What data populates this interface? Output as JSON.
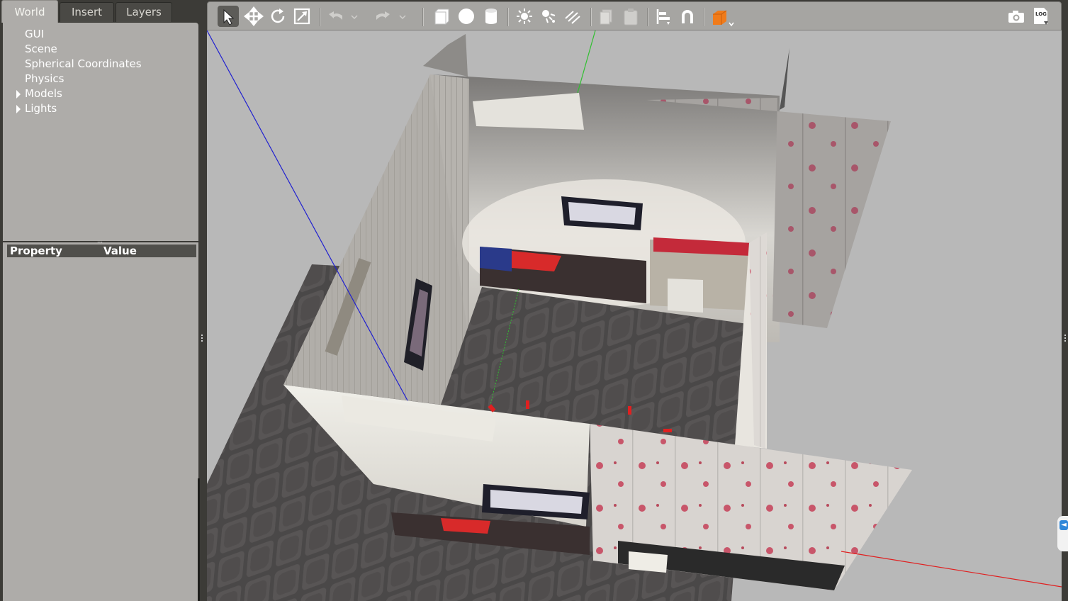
{
  "left_panel": {
    "tabs": [
      {
        "label": "World",
        "active": true
      },
      {
        "label": "Insert",
        "active": false
      },
      {
        "label": "Layers",
        "active": false
      }
    ],
    "tree": [
      {
        "label": "GUI",
        "expandable": false
      },
      {
        "label": "Scene",
        "expandable": false
      },
      {
        "label": "Spherical Coordinates",
        "expandable": false
      },
      {
        "label": "Physics",
        "expandable": false
      },
      {
        "label": "Models",
        "expandable": true
      },
      {
        "label": "Lights",
        "expandable": true
      }
    ],
    "properties": {
      "col_property": "Property",
      "col_value": "Value"
    }
  },
  "toolbar": {
    "tools": [
      {
        "name": "select-mode",
        "icon": "arrow-cursor-icon",
        "selected": true
      },
      {
        "name": "translate-mode",
        "icon": "move-arrows-icon"
      },
      {
        "name": "rotate-mode",
        "icon": "rotate-icon"
      },
      {
        "name": "scale-mode",
        "icon": "scale-icon"
      },
      {
        "name": "undo",
        "icon": "undo-icon"
      },
      {
        "name": "redo",
        "icon": "redo-icon"
      },
      {
        "name": "box-shape",
        "icon": "box-icon"
      },
      {
        "name": "sphere-shape",
        "icon": "sphere-icon"
      },
      {
        "name": "cylinder-shape",
        "icon": "cylinder-icon"
      },
      {
        "name": "point-light",
        "icon": "sun-icon"
      },
      {
        "name": "spot-light",
        "icon": "spot-light-icon"
      },
      {
        "name": "directional-light",
        "icon": "directional-light-icon"
      },
      {
        "name": "copy",
        "icon": "copy-icon"
      },
      {
        "name": "paste",
        "icon": "paste-icon"
      },
      {
        "name": "align",
        "icon": "align-icon"
      },
      {
        "name": "snap",
        "icon": "magnet-icon"
      },
      {
        "name": "view-angle",
        "icon": "view-cube-icon"
      },
      {
        "name": "screenshot",
        "icon": "camera-icon"
      },
      {
        "name": "log",
        "icon": "log-icon",
        "label": "LOG"
      }
    ]
  },
  "colors": {
    "panel_dark": "#3c3b37",
    "panel_light": "#aeaca9",
    "viewport_bg": "#b8b8b8",
    "accent_orange": "#f07b1a",
    "axis_x": "#e02020",
    "axis_y": "#30c030",
    "axis_z": "#2020d0"
  }
}
